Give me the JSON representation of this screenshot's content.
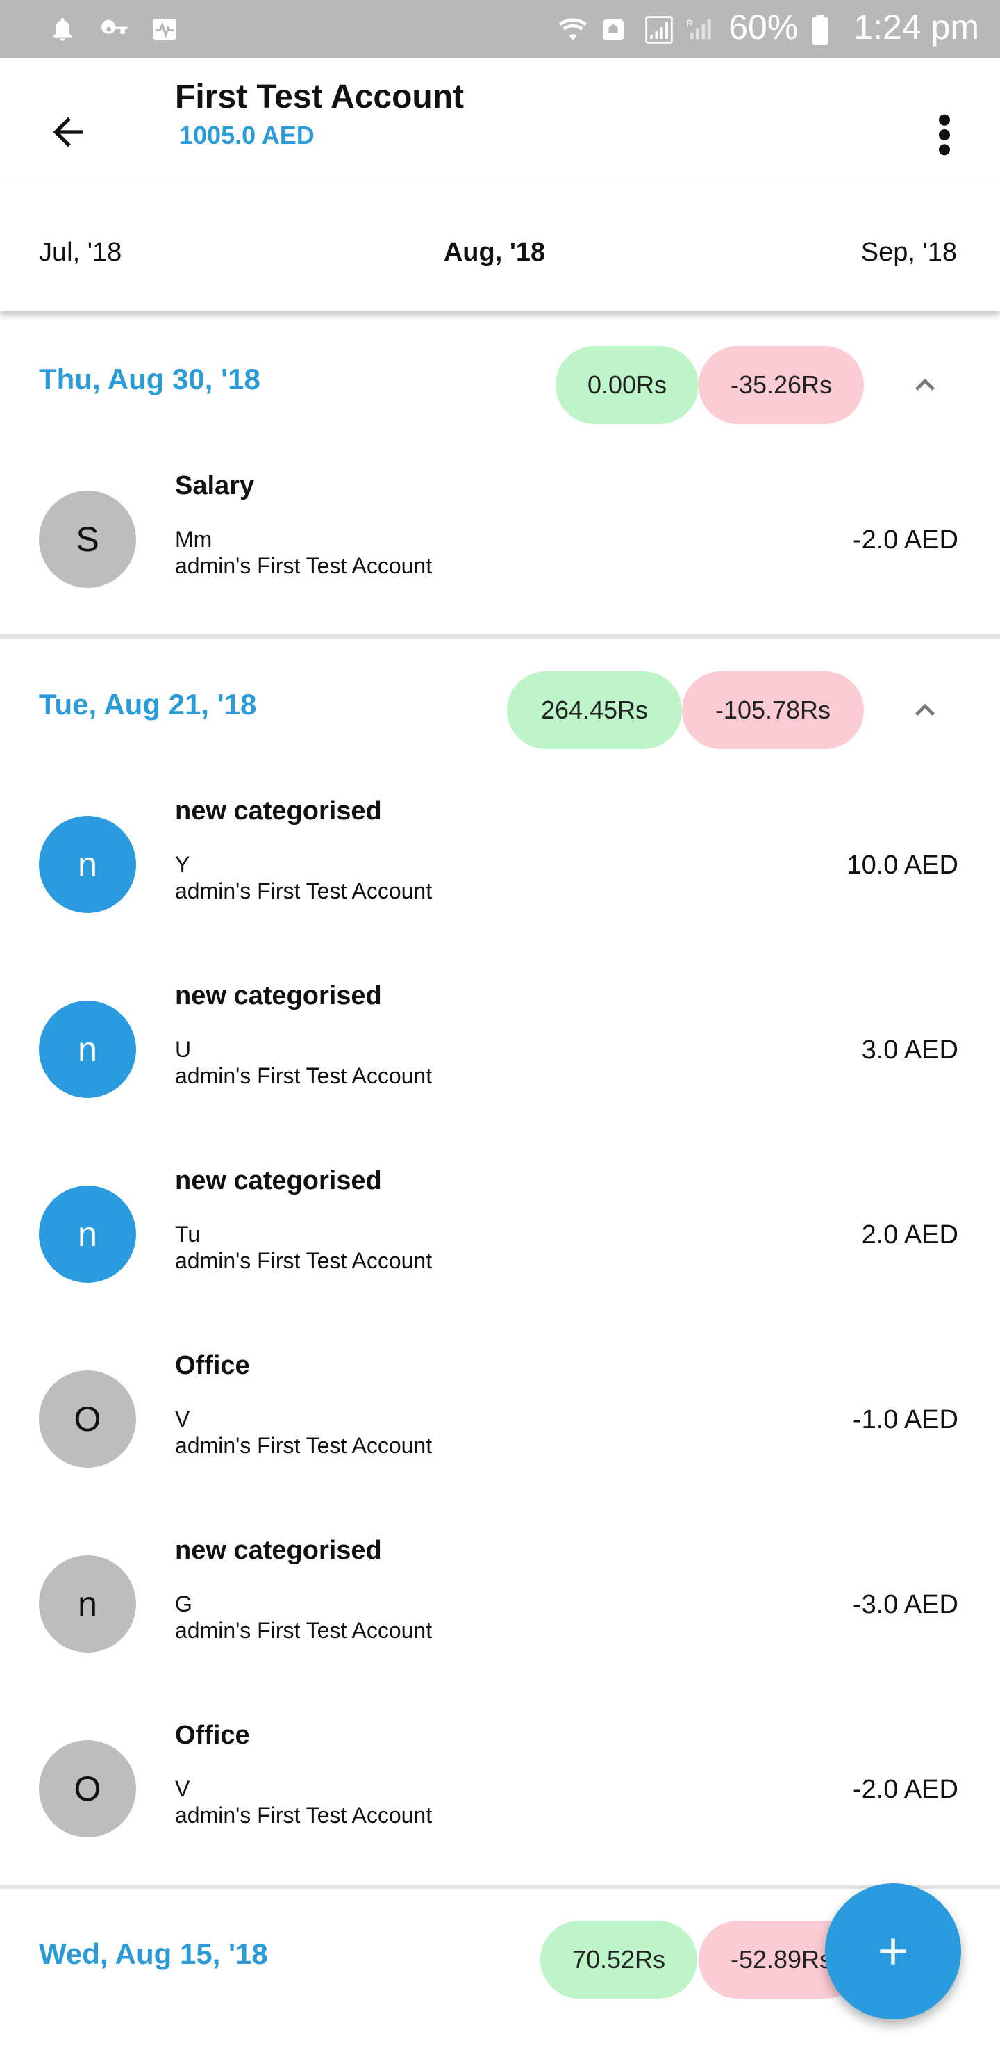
{
  "status_bar": {
    "battery": "60%",
    "time": "1:24 pm",
    "left_icons": [
      "bell-icon",
      "key-icon",
      "activity-icon"
    ],
    "right_icons": [
      "wifi-icon",
      "nfc-icon",
      "signal-icon",
      "signal-roaming-icon",
      "battery-icon"
    ]
  },
  "header": {
    "title": "First Test Account",
    "balance": "1005.0 AED",
    "back_icon": "arrow-left-icon",
    "menu_icon": "more-vert-icon"
  },
  "months": {
    "prev": "Jul, '18",
    "current": "Aug, '18",
    "next": "Sep, '18"
  },
  "colors": {
    "accent": "#2b9bd8",
    "income_pill": "#bdf5c8",
    "expense_pill": "#fcccd4",
    "avatar_grey": "#bdbdbd",
    "avatar_blue": "#2b9be0"
  },
  "groups": [
    {
      "date": "Thu, Aug 30, '18",
      "income": "0.00Rs",
      "expense": "-35.26Rs",
      "transactions": [
        {
          "avatar": "S",
          "avatar_color": "grey",
          "category": "Salary",
          "note": "Mm",
          "account": "admin's First  Test Account",
          "amount": "-2.0 AED"
        }
      ]
    },
    {
      "date": "Tue, Aug 21, '18",
      "income": "264.45Rs",
      "expense": "-105.78Rs",
      "transactions": [
        {
          "avatar": "n",
          "avatar_color": "blue",
          "category": "new categorised",
          "note": "Y",
          "account": "admin's First  Test Account",
          "amount": "10.0 AED"
        },
        {
          "avatar": "n",
          "avatar_color": "blue",
          "category": "new categorised",
          "note": "U",
          "account": "admin's First  Test Account",
          "amount": "3.0 AED"
        },
        {
          "avatar": "n",
          "avatar_color": "blue",
          "category": "new categorised",
          "note": "Tu",
          "account": "admin's First  Test Account",
          "amount": "2.0 AED"
        },
        {
          "avatar": "O",
          "avatar_color": "grey",
          "category": "Office",
          "note": "V",
          "account": "admin's First  Test Account",
          "amount": "-1.0 AED"
        },
        {
          "avatar": "n",
          "avatar_color": "grey",
          "category": "new categorised",
          "note": "G",
          "account": "admin's First  Test Account",
          "amount": "-3.0 AED"
        },
        {
          "avatar": "O",
          "avatar_color": "grey",
          "category": "Office",
          "note": "V",
          "account": "admin's First  Test Account",
          "amount": "-2.0 AED"
        }
      ]
    },
    {
      "date": "Wed, Aug 15, '18",
      "income": "70.52Rs",
      "expense": "-52.89Rs",
      "transactions": []
    }
  ],
  "fab": {
    "icon": "plus-icon"
  }
}
